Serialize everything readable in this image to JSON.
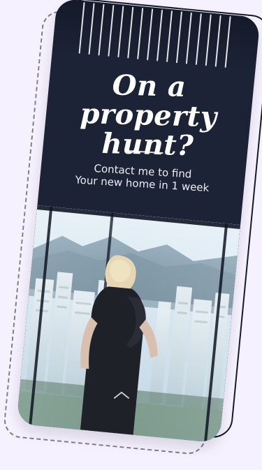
{
  "colors": {
    "background": "#F6F1FF",
    "card_dark": "#1C2336",
    "stripe_light": "#FFFFFF"
  },
  "promo": {
    "headline": "On a property\nhunt?",
    "subtext": "Contact me to find\nYour new home in 1 week"
  },
  "icons": {
    "up": "chevron-up-icon"
  }
}
